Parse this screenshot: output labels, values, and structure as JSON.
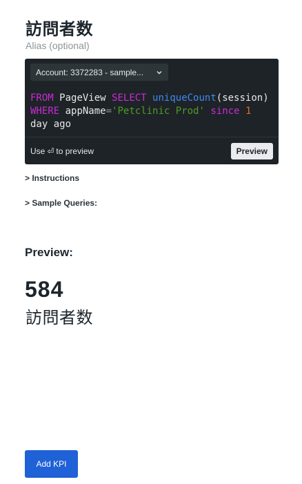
{
  "title": "訪問者数",
  "alias": "Alias (optional)",
  "editor": {
    "account_label": "Account: 3372283 - sample...",
    "query": {
      "kw_from": "FROM",
      "table": "PageView",
      "kw_select": "SELECT",
      "func": "uniqueCount",
      "args": "(session)",
      "kw_where": "WHERE",
      "field": "appName",
      "op": "=",
      "string": "'Petclinic Prod'",
      "kw_since": "since",
      "number": "1",
      "unit": "day",
      "tail": "ago"
    },
    "hint_prefix": "Use",
    "hint_suffix": "to preview",
    "preview_button": "Preview"
  },
  "instructions_toggle": "> Instructions",
  "sample_queries_toggle": "> Sample Queries:",
  "preview": {
    "heading": "Preview:",
    "value": "584",
    "label": "訪問者数"
  },
  "add_button": "Add KPI"
}
